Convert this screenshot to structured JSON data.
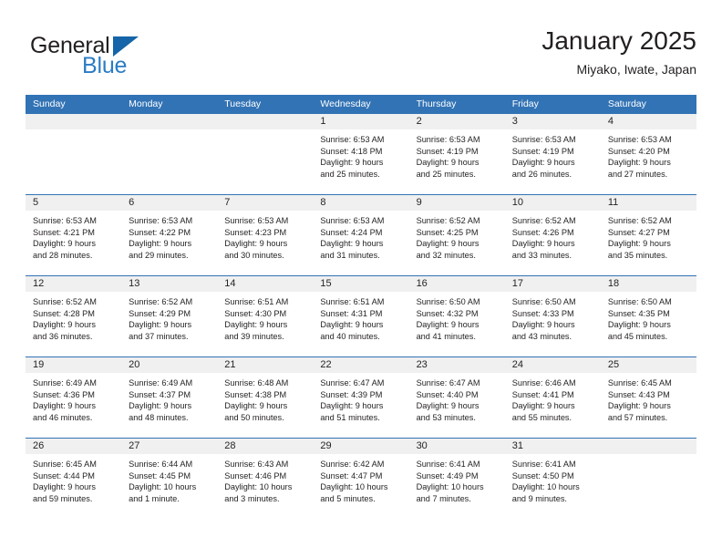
{
  "brand": {
    "name_top": "General",
    "name_bottom": "Blue",
    "accent_color": "#2b7cc4",
    "triangle_color": "#1565a8"
  },
  "header": {
    "title": "January 2025",
    "subtitle": "Miyako, Iwate, Japan"
  },
  "theme": {
    "header_blue": "#3273B5",
    "date_band_gray": "#F0F0F0",
    "text": "#231F20"
  },
  "weekdays": [
    "Sunday",
    "Monday",
    "Tuesday",
    "Wednesday",
    "Thursday",
    "Friday",
    "Saturday"
  ],
  "weeks": [
    [
      {
        "day": "",
        "lines": []
      },
      {
        "day": "",
        "lines": []
      },
      {
        "day": "",
        "lines": []
      },
      {
        "day": "1",
        "lines": [
          "Sunrise: 6:53 AM",
          "Sunset: 4:18 PM",
          "Daylight: 9 hours",
          "and 25 minutes."
        ]
      },
      {
        "day": "2",
        "lines": [
          "Sunrise: 6:53 AM",
          "Sunset: 4:19 PM",
          "Daylight: 9 hours",
          "and 25 minutes."
        ]
      },
      {
        "day": "3",
        "lines": [
          "Sunrise: 6:53 AM",
          "Sunset: 4:19 PM",
          "Daylight: 9 hours",
          "and 26 minutes."
        ]
      },
      {
        "day": "4",
        "lines": [
          "Sunrise: 6:53 AM",
          "Sunset: 4:20 PM",
          "Daylight: 9 hours",
          "and 27 minutes."
        ]
      }
    ],
    [
      {
        "day": "5",
        "lines": [
          "Sunrise: 6:53 AM",
          "Sunset: 4:21 PM",
          "Daylight: 9 hours",
          "and 28 minutes."
        ]
      },
      {
        "day": "6",
        "lines": [
          "Sunrise: 6:53 AM",
          "Sunset: 4:22 PM",
          "Daylight: 9 hours",
          "and 29 minutes."
        ]
      },
      {
        "day": "7",
        "lines": [
          "Sunrise: 6:53 AM",
          "Sunset: 4:23 PM",
          "Daylight: 9 hours",
          "and 30 minutes."
        ]
      },
      {
        "day": "8",
        "lines": [
          "Sunrise: 6:53 AM",
          "Sunset: 4:24 PM",
          "Daylight: 9 hours",
          "and 31 minutes."
        ]
      },
      {
        "day": "9",
        "lines": [
          "Sunrise: 6:52 AM",
          "Sunset: 4:25 PM",
          "Daylight: 9 hours",
          "and 32 minutes."
        ]
      },
      {
        "day": "10",
        "lines": [
          "Sunrise: 6:52 AM",
          "Sunset: 4:26 PM",
          "Daylight: 9 hours",
          "and 33 minutes."
        ]
      },
      {
        "day": "11",
        "lines": [
          "Sunrise: 6:52 AM",
          "Sunset: 4:27 PM",
          "Daylight: 9 hours",
          "and 35 minutes."
        ]
      }
    ],
    [
      {
        "day": "12",
        "lines": [
          "Sunrise: 6:52 AM",
          "Sunset: 4:28 PM",
          "Daylight: 9 hours",
          "and 36 minutes."
        ]
      },
      {
        "day": "13",
        "lines": [
          "Sunrise: 6:52 AM",
          "Sunset: 4:29 PM",
          "Daylight: 9 hours",
          "and 37 minutes."
        ]
      },
      {
        "day": "14",
        "lines": [
          "Sunrise: 6:51 AM",
          "Sunset: 4:30 PM",
          "Daylight: 9 hours",
          "and 39 minutes."
        ]
      },
      {
        "day": "15",
        "lines": [
          "Sunrise: 6:51 AM",
          "Sunset: 4:31 PM",
          "Daylight: 9 hours",
          "and 40 minutes."
        ]
      },
      {
        "day": "16",
        "lines": [
          "Sunrise: 6:50 AM",
          "Sunset: 4:32 PM",
          "Daylight: 9 hours",
          "and 41 minutes."
        ]
      },
      {
        "day": "17",
        "lines": [
          "Sunrise: 6:50 AM",
          "Sunset: 4:33 PM",
          "Daylight: 9 hours",
          "and 43 minutes."
        ]
      },
      {
        "day": "18",
        "lines": [
          "Sunrise: 6:50 AM",
          "Sunset: 4:35 PM",
          "Daylight: 9 hours",
          "and 45 minutes."
        ]
      }
    ],
    [
      {
        "day": "19",
        "lines": [
          "Sunrise: 6:49 AM",
          "Sunset: 4:36 PM",
          "Daylight: 9 hours",
          "and 46 minutes."
        ]
      },
      {
        "day": "20",
        "lines": [
          "Sunrise: 6:49 AM",
          "Sunset: 4:37 PM",
          "Daylight: 9 hours",
          "and 48 minutes."
        ]
      },
      {
        "day": "21",
        "lines": [
          "Sunrise: 6:48 AM",
          "Sunset: 4:38 PM",
          "Daylight: 9 hours",
          "and 50 minutes."
        ]
      },
      {
        "day": "22",
        "lines": [
          "Sunrise: 6:47 AM",
          "Sunset: 4:39 PM",
          "Daylight: 9 hours",
          "and 51 minutes."
        ]
      },
      {
        "day": "23",
        "lines": [
          "Sunrise: 6:47 AM",
          "Sunset: 4:40 PM",
          "Daylight: 9 hours",
          "and 53 minutes."
        ]
      },
      {
        "day": "24",
        "lines": [
          "Sunrise: 6:46 AM",
          "Sunset: 4:41 PM",
          "Daylight: 9 hours",
          "and 55 minutes."
        ]
      },
      {
        "day": "25",
        "lines": [
          "Sunrise: 6:45 AM",
          "Sunset: 4:43 PM",
          "Daylight: 9 hours",
          "and 57 minutes."
        ]
      }
    ],
    [
      {
        "day": "26",
        "lines": [
          "Sunrise: 6:45 AM",
          "Sunset: 4:44 PM",
          "Daylight: 9 hours",
          "and 59 minutes."
        ]
      },
      {
        "day": "27",
        "lines": [
          "Sunrise: 6:44 AM",
          "Sunset: 4:45 PM",
          "Daylight: 10 hours",
          "and 1 minute."
        ]
      },
      {
        "day": "28",
        "lines": [
          "Sunrise: 6:43 AM",
          "Sunset: 4:46 PM",
          "Daylight: 10 hours",
          "and 3 minutes."
        ]
      },
      {
        "day": "29",
        "lines": [
          "Sunrise: 6:42 AM",
          "Sunset: 4:47 PM",
          "Daylight: 10 hours",
          "and 5 minutes."
        ]
      },
      {
        "day": "30",
        "lines": [
          "Sunrise: 6:41 AM",
          "Sunset: 4:49 PM",
          "Daylight: 10 hours",
          "and 7 minutes."
        ]
      },
      {
        "day": "31",
        "lines": [
          "Sunrise: 6:41 AM",
          "Sunset: 4:50 PM",
          "Daylight: 10 hours",
          "and 9 minutes."
        ]
      },
      {
        "day": "",
        "lines": []
      }
    ]
  ]
}
